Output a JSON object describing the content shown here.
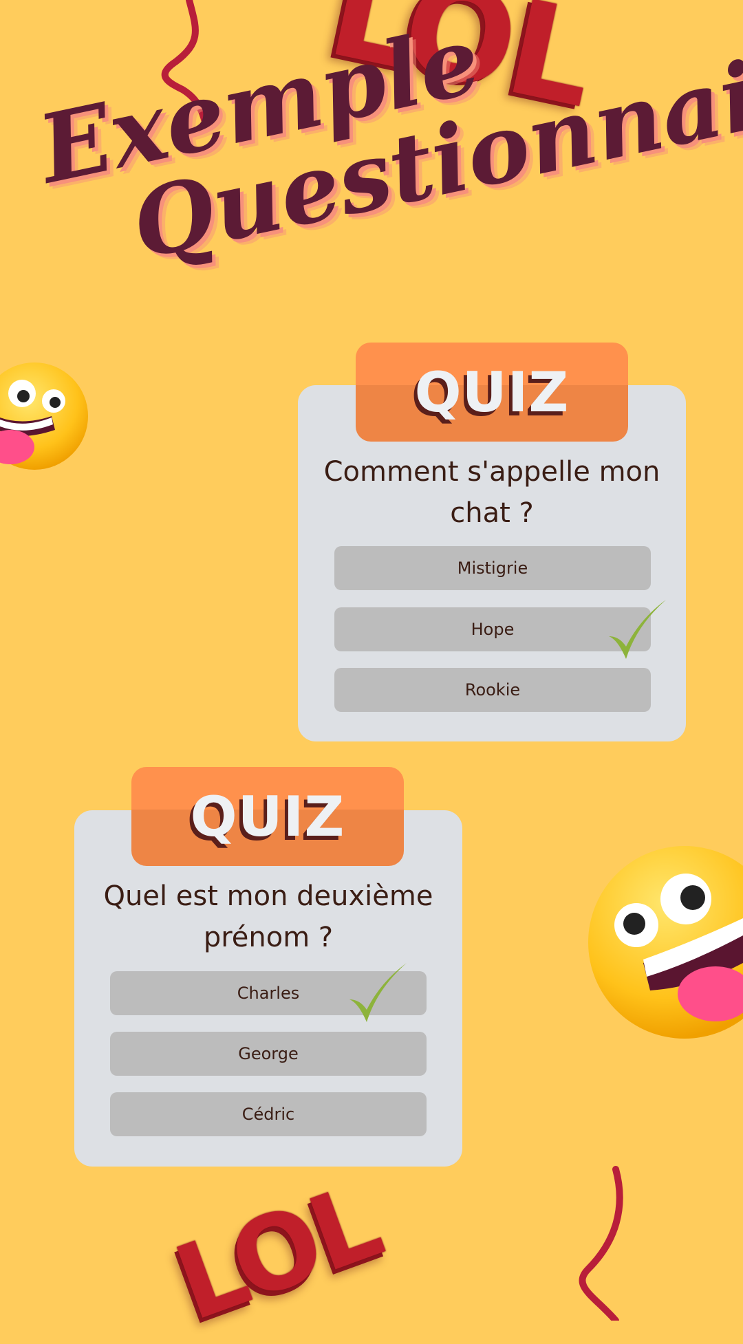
{
  "title": {
    "line1": "Exemple",
    "line2": "Questionnaire"
  },
  "decorations": {
    "balloon_text_top": "LOL",
    "balloon_text_bottom": "LOL"
  },
  "colors": {
    "background": "#FFCC5C",
    "title": "#5C1B35",
    "title_shadow": "#F7917B",
    "card": "#DDE0E4",
    "quiz_header": "#FF914D",
    "answer": "#BCBCBC",
    "check": "#8DB33B",
    "balloon": "#C01F2A"
  },
  "quizzes": [
    {
      "header": "QUIZ",
      "question": "Comment s'appelle mon chat ?",
      "answers": [
        "Mistigrie",
        "Hope",
        "Rookie"
      ],
      "correct_answer": "Hope"
    },
    {
      "header": "QUIZ",
      "question": "Quel est mon deuxième prénom ?",
      "answers": [
        "Charles",
        "George",
        "Cédric"
      ],
      "correct_answer": "Charles"
    }
  ],
  "icons": [
    "zany-face-emoji-icon",
    "checkmark-icon",
    "ribbon-streamer-icon",
    "balloon-letters-icon"
  ]
}
